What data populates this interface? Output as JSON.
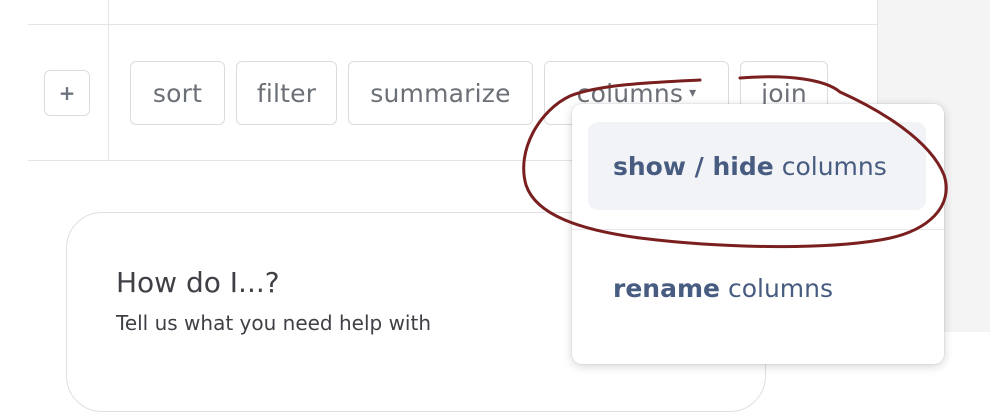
{
  "toolbar": {
    "add_label": "+",
    "chips": {
      "sort": "sort",
      "filter": "filter",
      "summarize": "summarize",
      "columns": "columns",
      "join": "join"
    },
    "columns_caret": "▾"
  },
  "columns_menu": {
    "items": [
      {
        "bold": "show / hide",
        "rest": "columns"
      },
      {
        "bold": "rename",
        "rest": "columns"
      }
    ]
  },
  "help_card": {
    "title": "How do I...?",
    "subtitle": "Tell us what you need help with"
  },
  "colors": {
    "menu_text": "#475c80",
    "annotation": "#7a1f1f",
    "active_item_bg": "#f1f3f6"
  }
}
